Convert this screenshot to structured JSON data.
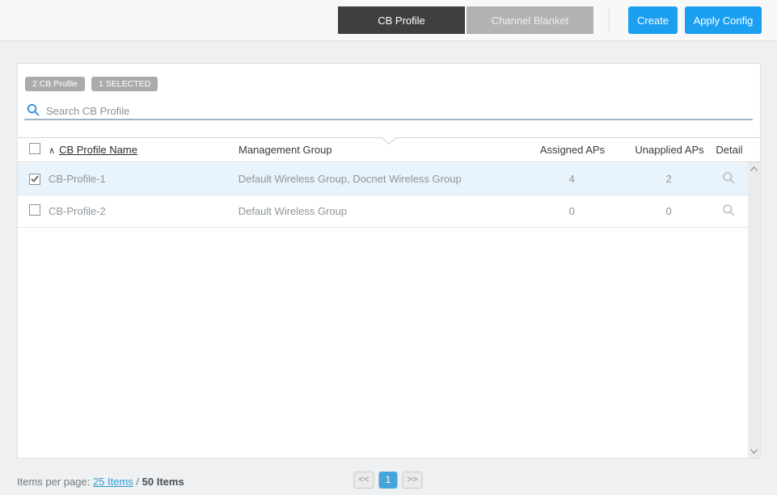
{
  "header": {
    "tabs": [
      {
        "label": "CB Profile",
        "active": true
      },
      {
        "label": "Channel Blanket",
        "active": false
      }
    ],
    "create_label": "Create",
    "apply_config_label": "Apply Config"
  },
  "panel": {
    "badges": [
      {
        "label": "2 CB Profile"
      },
      {
        "label": "1 SELECTED"
      }
    ],
    "search": {
      "placeholder": "Search CB Profile",
      "value": ""
    },
    "table": {
      "sort_indicator": "∧",
      "columns": [
        "CB Profile Name",
        "Management Group",
        "Assigned APs",
        "Unapplied APs",
        "Detail"
      ],
      "rows": [
        {
          "name": "CB-Profile-1",
          "management_group": "Default Wireless Group, Docnet Wireless Group",
          "assigned_aps": "4",
          "unapplied_aps": "2",
          "checked": true,
          "selected": true
        },
        {
          "name": "CB-Profile-2",
          "management_group": "Default Wireless Group",
          "assigned_aps": "0",
          "unapplied_aps": "0",
          "checked": false,
          "selected": false
        }
      ]
    }
  },
  "footer": {
    "items_per_page_label": "Items per page:",
    "items_per_page_link": "25 Items",
    "separator": " / ",
    "total_items": "50 Items",
    "pagination": {
      "prev": "<<",
      "page": "1",
      "next": ">>"
    }
  },
  "colors": {
    "accent_blue": "#1b9ff0",
    "active_page_blue": "#45a7d9",
    "active_tab": "#3f3f3f",
    "inactive_tab": "#b2b2b2",
    "badge_gray": "#ababab",
    "selected_row": "#e9f3fb",
    "link_blue": "#2b9fd8",
    "search_underline": "#9fb4c4"
  }
}
